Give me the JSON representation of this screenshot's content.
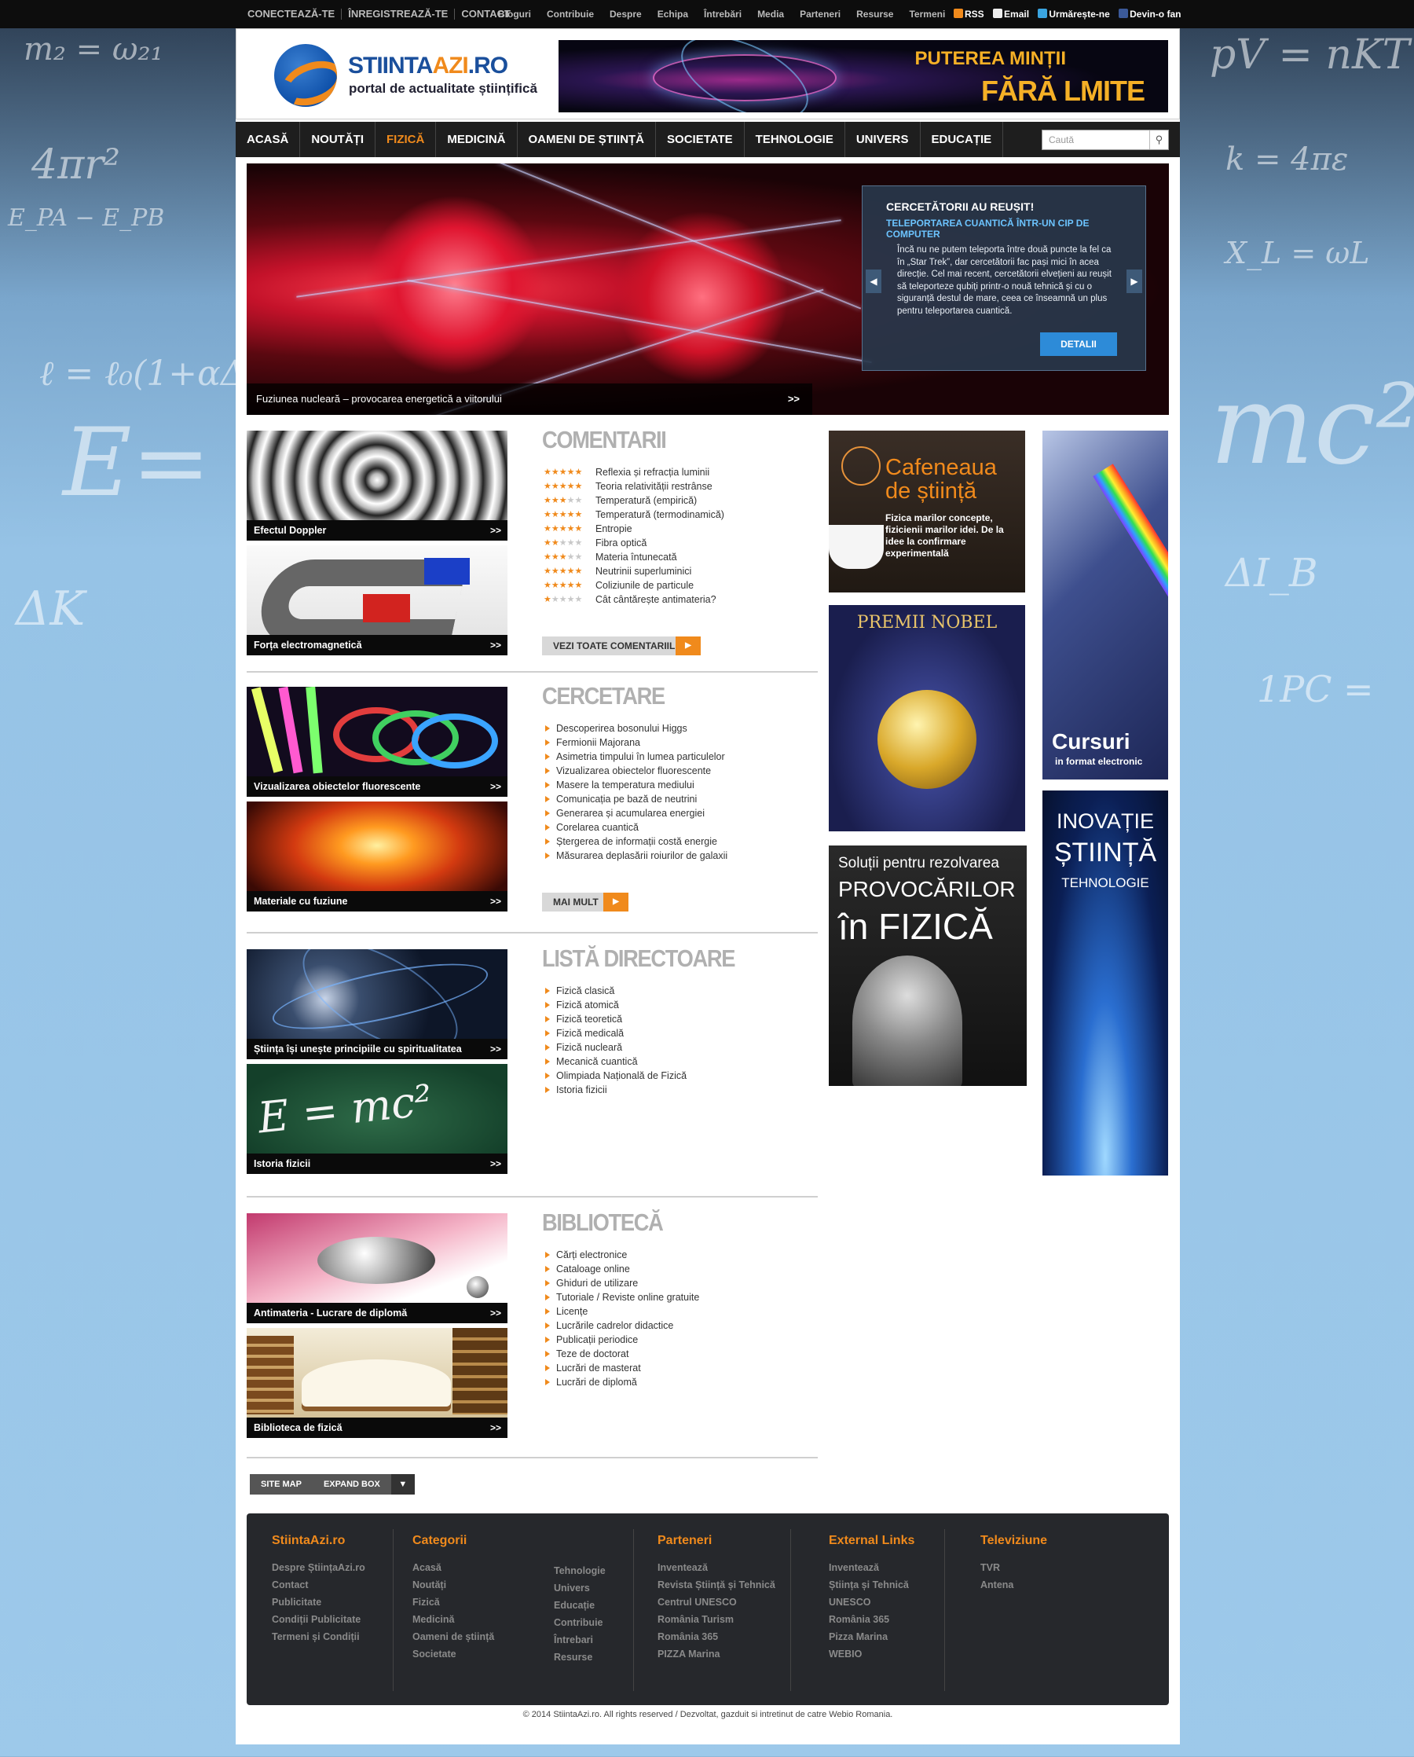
{
  "topbar": {
    "account": [
      "CONECTEAZĂ-TE",
      "ÎNREGISTREAZĂ-TE",
      "CONTACT"
    ],
    "menu": [
      "Bloguri",
      "Contribuie",
      "Despre",
      "Echipa",
      "Întrebări",
      "Media",
      "Parteneri",
      "Resurse",
      "Termeni"
    ],
    "social": [
      "RSS",
      "Email",
      "Urmărește-ne",
      "Devin-o fan"
    ]
  },
  "header": {
    "logo_brand": "STIINTA",
    "logo_accent": "AZI",
    "logo_tld": ".RO",
    "tagline": "portal de actualitate științifică",
    "banner_line1": "PUTEREA MINȚII",
    "banner_line2": "FĂRĂ LMITE"
  },
  "nav": {
    "items": [
      "ACASĂ",
      "NOUTĂȚI",
      "FIZICĂ",
      "MEDICINĂ",
      "OAMENI DE ȘTIINȚĂ",
      "SOCIETATE",
      "TEHNOLOGIE",
      "UNIVERS",
      "EDUCAȚIE"
    ],
    "active": "FIZICĂ",
    "search_placeholder": "Caută"
  },
  "slider": {
    "caption": "Fuziunea nucleară – provocarea energetică a viitorului",
    "caption_more": ">>",
    "card_title": "CERCETĂTORII AU REUȘIT!",
    "card_subtitle": "TELEPORTAREA CUANTICĂ ÎNTR-UN CIP DE COMPUTER",
    "card_text": "Încă nu ne putem teleporta între două puncte la fel ca în „Star Trek”, dar cercetătorii fac pași mici în acea direcție. Cel mai recent, cercetătorii elvețieni au reușit să teleporteze qubiți printr-o nouă tehnică și cu o siguranță destul de mare, ceea ce înseamnă un plus pentru teleportarea cuantică.",
    "card_button": "DETALII"
  },
  "thumbs": [
    {
      "caption": "Efectul Doppler",
      "more": ">>"
    },
    {
      "caption": "Forța electromagnetică",
      "more": ">>"
    },
    {
      "caption": "Vizualizarea obiectelor fluorescente",
      "more": ">>"
    },
    {
      "caption": "Materiale cu fuziune",
      "more": ">>"
    },
    {
      "caption": "Știința își unește principiile cu spiritualitatea",
      "more": ">>"
    },
    {
      "caption": "Istoria fizicii",
      "more": ">>"
    },
    {
      "caption": "Antimateria - Lucrare de diplomă",
      "more": ">>"
    },
    {
      "caption": "Biblioteca de fizică",
      "more": ">>"
    }
  ],
  "comentarii": {
    "title": "COMENTARII",
    "items": [
      {
        "label": "Reflexia și refracția luminii",
        "rating": 5
      },
      {
        "label": "Teoria relativității restrânse",
        "rating": 5
      },
      {
        "label": "Temperatură (empirică)",
        "rating": 3
      },
      {
        "label": "Temperatură (termodinamică)",
        "rating": 5
      },
      {
        "label": "Entropie",
        "rating": 5
      },
      {
        "label": "Fibra optică",
        "rating": 2
      },
      {
        "label": "Materia întunecată",
        "rating": 3
      },
      {
        "label": "Neutrinii superluminici",
        "rating": 5
      },
      {
        "label": "Coliziunile de particule",
        "rating": 5
      },
      {
        "label": "Cât cântărește antimateria?",
        "rating": 1
      }
    ],
    "button": "VEZI TOATE COMENTARIILE"
  },
  "cercetare": {
    "title": "CERCETARE",
    "items": [
      "Descoperirea bosonului Higgs",
      "Fermionii Majorana",
      "Asimetria timpului în lumea particulelor",
      "Vizualizarea obiectelor fluorescente",
      "Masere la temperatura mediului",
      "Comunicația pe bază de neutrini",
      "Generarea și acumularea energiei",
      "Corelarea cuantică",
      "Ștergerea de informații costă energie",
      "Măsurarea deplasării roiurilor de galaxii"
    ],
    "button": "MAI MULT"
  },
  "directoare": {
    "title": "LISTĂ DIRECTOARE",
    "items": [
      "Fizică clasică",
      "Fizică atomică",
      "Fizică teoretică",
      "Fizică medicală",
      "Fizică nucleară",
      "Mecanică cuantică",
      "Olimpiada Națională de Fizică",
      "Istoria fizicii"
    ]
  },
  "biblioteca": {
    "title": "BIBLIOTECĂ",
    "items": [
      "Cărți electronice",
      "Cataloage online",
      "Ghiduri de utilizare",
      "Tutoriale / Reviste online gratuite",
      "Licențe",
      "Lucrările cadrelor didactice",
      "Publicații periodice",
      "Teze de doctorat",
      "Lucrări de masterat",
      "Lucrări de diplomă"
    ]
  },
  "ads": {
    "cafenea_title": "Cafeneaua de știință",
    "cafenea_text": "Fizica marilor concepte, fizicienii marilor idei. De la idee la confirmare experimentală",
    "nobel": "PREMII NOBEL",
    "solutii_1": "Soluții pentru rezolvarea",
    "solutii_2": "PROVOCĂRILOR",
    "solutii_3": "în FIZICĂ",
    "cursuri_1": "Cursuri",
    "cursuri_2": "in format electronic",
    "inovatie_1": "INOVAȚIE",
    "inovatie_2": "ȘTIINȚĂ",
    "inovatie_3": "TEHNOLOGIE"
  },
  "sitemap": {
    "site_map": "SITE MAP",
    "expand": "EXPAND BOX",
    "arrow": "▼"
  },
  "footer": {
    "col1_title": "StiintaAzi.ro",
    "col1": [
      "Despre ȘtiințaAzi.ro",
      "Contact",
      "Publicitate",
      "Condiții Publicitate",
      "Termeni și Condiții"
    ],
    "col2_title": "Categorii",
    "col2a": [
      "Acasă",
      "Noutăți",
      "Fizică",
      "Medicină",
      "Oameni de știință",
      "Societate"
    ],
    "col2b": [
      "Tehnologie",
      "Univers",
      "Educație",
      "Contribuie",
      "Întrebari",
      "Resurse"
    ],
    "col3_title": "Parteneri",
    "col3": [
      "Inventează",
      "Revista Știință și Tehnică",
      "Centrul UNESCO",
      "România Turism",
      "România 365",
      "PIZZA Marina"
    ],
    "col4_title": "External Links",
    "col4": [
      "Inventează",
      "Știința și Tehnică",
      "UNESCO",
      "România 365",
      "Pizza Marina",
      "WEBIO"
    ],
    "col5_title": "Televiziune",
    "col5": [
      "TVR",
      "Antena"
    ],
    "copyright": "© 2014 StiintaAzi.ro. All rights reserved / Dezvoltat, gazduit si intretinut de catre Webio Romania."
  },
  "colors": {
    "accent": "#f08a1c",
    "nav_bg": "#1e1e1e",
    "link_blue": "#2d8bd8"
  }
}
